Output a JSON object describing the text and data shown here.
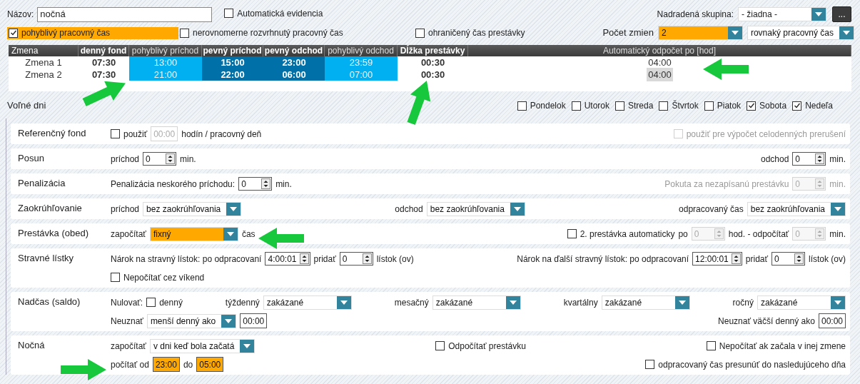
{
  "header": {
    "name_label": "Názov:",
    "name_value": "nočná",
    "auto_evidence": {
      "label": "Automatická evidencia",
      "checked": false
    },
    "parent_group_label": "Nadradená skupina:",
    "parent_group_value": "- žiadna -",
    "more_button": "..."
  },
  "options": [
    {
      "label": "pohyblivý pracovný čas",
      "checked": true
    },
    {
      "label": "nerovnomerne rozvrhnutý pracovný čas",
      "checked": false
    },
    {
      "label": "ohraničený čas prestávky",
      "checked": false
    }
  ],
  "shift_count": {
    "label": "Počet zmien",
    "value": "2",
    "highlighted": true
  },
  "work_time_mode": {
    "value": "rovnaký pracovný čas"
  },
  "shifts_table": {
    "columns": [
      {
        "label": "Zmena",
        "kind": "name"
      },
      {
        "label": "denný fond",
        "kind": "fund"
      },
      {
        "label": "pohyblivý príchod",
        "kind": "flex"
      },
      {
        "label": "pevný príchod",
        "kind": "fixed"
      },
      {
        "label": "pevný odchod",
        "kind": "fixed"
      },
      {
        "label": "pohyblivý odchod",
        "kind": "flex"
      },
      {
        "label": "Dĺžka prestávky",
        "kind": "break"
      },
      {
        "label": "Automatický odpočet po [hod]",
        "kind": "auto"
      }
    ],
    "rows": [
      {
        "cells": [
          "Zmena 1",
          "07:30",
          "13:00",
          "15:00",
          "23:00",
          "23:59",
          "00:30",
          "04:00"
        ],
        "focused": false
      },
      {
        "cells": [
          "Zmena 2",
          "07:30",
          "21:00",
          "22:00",
          "06:00",
          "07:00",
          "00:30",
          "04:00"
        ],
        "focused": true
      }
    ]
  },
  "free_days": {
    "label": "Voľné dni",
    "days": [
      {
        "label": "Pondelok",
        "checked": false
      },
      {
        "label": "Utorok",
        "checked": false
      },
      {
        "label": "Streda",
        "checked": false
      },
      {
        "label": "Štvrtok",
        "checked": false
      },
      {
        "label": "Piatok",
        "checked": false
      },
      {
        "label": "Sobota",
        "checked": true
      },
      {
        "label": "Nedeľa",
        "checked": true
      }
    ]
  },
  "sections": [
    {
      "title": "Referenčný fond",
      "lines": [
        {
          "groups": [
            {
              "items": [
                {
                  "kind": "checkbox",
                  "label": "použiť",
                  "checked": false,
                  "disabled": false
                },
                {
                  "kind": "time",
                  "value": "00:00",
                  "highlighted": false,
                  "disabled": true
                },
                {
                  "kind": "text",
                  "text": "hodín / pracovný deň",
                  "disabled": false
                }
              ]
            },
            {
              "items": [
                {
                  "kind": "checkbox",
                  "label": "použiť pre výpočet celodenných prerušení",
                  "checked": false,
                  "disabled": true
                }
              ]
            }
          ]
        }
      ]
    },
    {
      "title": "Posun",
      "lines": [
        {
          "groups": [
            {
              "items": [
                {
                  "kind": "text",
                  "text": "príchod",
                  "disabled": false
                },
                {
                  "kind": "spinner",
                  "value": "0",
                  "disabled": false
                },
                {
                  "kind": "text",
                  "text": "min.",
                  "disabled": false
                }
              ]
            },
            {
              "items": [
                {
                  "kind": "text",
                  "text": "odchod",
                  "disabled": false
                },
                {
                  "kind": "spinner",
                  "value": "0",
                  "disabled": false
                },
                {
                  "kind": "text",
                  "text": "min.",
                  "disabled": false
                }
              ]
            }
          ]
        }
      ]
    },
    {
      "title": "Penalizácia",
      "lines": [
        {
          "groups": [
            {
              "items": [
                {
                  "kind": "text",
                  "text": "Penalizácia neskorého príchodu:",
                  "disabled": false
                },
                {
                  "kind": "spinner",
                  "value": "0",
                  "disabled": false
                },
                {
                  "kind": "text",
                  "text": "min.",
                  "disabled": false
                }
              ]
            },
            {
              "items": [
                {
                  "kind": "text",
                  "text": "Pokuta za nezapísanú prestávku",
                  "disabled": true
                },
                {
                  "kind": "spinner",
                  "value": "0",
                  "disabled": true
                },
                {
                  "kind": "text",
                  "text": "min.",
                  "disabled": true
                }
              ]
            }
          ]
        }
      ]
    },
    {
      "title": "Zaokrúhľovanie",
      "lines": [
        {
          "groups": [
            {
              "items": [
                {
                  "kind": "text",
                  "text": "príchod",
                  "disabled": false
                },
                {
                  "kind": "select",
                  "value": "bez zaokrúhľovania",
                  "highlighted": false
                }
              ]
            },
            {
              "items": [
                {
                  "kind": "text",
                  "text": "odchod",
                  "disabled": false
                },
                {
                  "kind": "select",
                  "value": "bez zaokrúhľovania",
                  "highlighted": false
                }
              ]
            },
            {
              "items": [
                {
                  "kind": "text",
                  "text": "odpracovaný čas",
                  "disabled": false
                },
                {
                  "kind": "select",
                  "value": "bez zaokrúhľovania",
                  "highlighted": false
                }
              ]
            }
          ]
        }
      ]
    },
    {
      "title": "Prestávka (obed)",
      "lines": [
        {
          "groups": [
            {
              "items": [
                {
                  "kind": "text",
                  "text": "započítať",
                  "disabled": false
                },
                {
                  "kind": "select",
                  "value": "fixný",
                  "highlighted": true
                },
                {
                  "kind": "text",
                  "text": "čas",
                  "disabled": false
                }
              ]
            },
            {
              "items": [
                {
                  "kind": "checkbox",
                  "label": "2. prestávka automaticky",
                  "checked": false,
                  "disabled": false
                },
                {
                  "kind": "text",
                  "text": "po",
                  "disabled": false
                },
                {
                  "kind": "spinner",
                  "value": "0",
                  "disabled": true
                },
                {
                  "kind": "text",
                  "text": "hod. - odpočítať",
                  "disabled": false
                },
                {
                  "kind": "spinner",
                  "value": "0",
                  "disabled": true
                },
                {
                  "kind": "text",
                  "text": "min.",
                  "disabled": false
                }
              ]
            }
          ]
        }
      ]
    },
    {
      "title": "Stravné lístky",
      "lines": [
        {
          "groups": [
            {
              "items": [
                {
                  "kind": "text",
                  "text": "Nárok na stravný lístok: po odpracovaní",
                  "disabled": false
                },
                {
                  "kind": "spinner",
                  "value": "4:00:01",
                  "disabled": false
                },
                {
                  "kind": "text",
                  "text": "pridať",
                  "disabled": false
                },
                {
                  "kind": "spinner",
                  "value": "0",
                  "disabled": false
                },
                {
                  "kind": "text",
                  "text": "lístok (ov)",
                  "disabled": false
                }
              ]
            },
            {
              "items": [
                {
                  "kind": "text",
                  "text": "Nárok na ďalší stravný lístok: po odpracovaní",
                  "disabled": false
                },
                {
                  "kind": "spinner",
                  "value": "12:00:01",
                  "disabled": false
                },
                {
                  "kind": "text",
                  "text": "pridať",
                  "disabled": false
                },
                {
                  "kind": "spinner",
                  "value": "0",
                  "disabled": false
                },
                {
                  "kind": "text",
                  "text": "lístok (ov)",
                  "disabled": false
                }
              ]
            }
          ]
        },
        {
          "groups": [
            {
              "items": [
                {
                  "kind": "checkbox",
                  "label": "Nepočítať cez víkend",
                  "checked": false,
                  "disabled": false
                }
              ]
            }
          ]
        }
      ]
    },
    {
      "title": "Nadčas (saldo)",
      "lines": [
        {
          "groups": [
            {
              "items": [
                {
                  "kind": "text",
                  "text": "Nulovať:",
                  "disabled": false
                },
                {
                  "kind": "checkbox",
                  "label": "denný",
                  "checked": false,
                  "disabled": false
                }
              ]
            },
            {
              "items": [
                {
                  "kind": "text",
                  "text": "týždenný",
                  "disabled": false
                },
                {
                  "kind": "select",
                  "value": "zakázané",
                  "highlighted": false
                }
              ]
            },
            {
              "items": [
                {
                  "kind": "text",
                  "text": "mesačný",
                  "disabled": false
                },
                {
                  "kind": "select",
                  "value": "zakázané",
                  "highlighted": false
                }
              ]
            },
            {
              "items": [
                {
                  "kind": "text",
                  "text": "kvartálny",
                  "disabled": false
                },
                {
                  "kind": "select",
                  "value": "zakázané",
                  "highlighted": false
                }
              ]
            },
            {
              "items": [
                {
                  "kind": "text",
                  "text": "ročný",
                  "disabled": false
                },
                {
                  "kind": "select",
                  "value": "zakázané",
                  "highlighted": false
                }
              ]
            }
          ]
        },
        {
          "groups": [
            {
              "items": [
                {
                  "kind": "text",
                  "text": "Neuznať",
                  "disabled": false
                },
                {
                  "kind": "select",
                  "value": "menší denný ako",
                  "highlighted": false
                },
                {
                  "kind": "time",
                  "value": "00:00",
                  "highlighted": false,
                  "disabled": false
                }
              ]
            },
            {
              "items": [
                {
                  "kind": "text",
                  "text": "Neuznať väčší denný ako",
                  "disabled": false
                },
                {
                  "kind": "time",
                  "value": "00:00",
                  "highlighted": false,
                  "disabled": false
                }
              ]
            }
          ]
        }
      ]
    },
    {
      "title": "Nočná",
      "lines": [
        {
          "groups": [
            {
              "items": [
                {
                  "kind": "text",
                  "text": "započítať",
                  "disabled": false
                },
                {
                  "kind": "select",
                  "value": "v dni keď bola začatá",
                  "highlighted": false
                }
              ]
            },
            {
              "items": [
                {
                  "kind": "checkbox",
                  "label": "Odpočítať prestávku",
                  "checked": false,
                  "disabled": false
                }
              ]
            },
            {
              "items": [
                {
                  "kind": "checkbox",
                  "label": "Nepočítať ak začala v inej zmene",
                  "checked": false,
                  "disabled": false
                }
              ]
            }
          ]
        },
        {
          "groups": [
            {
              "items": [
                {
                  "kind": "text",
                  "text": "počítať od",
                  "disabled": false
                },
                {
                  "kind": "time",
                  "value": "23:00",
                  "highlighted": true,
                  "disabled": false
                },
                {
                  "kind": "text",
                  "text": "do",
                  "disabled": false
                },
                {
                  "kind": "time",
                  "value": "05:00",
                  "highlighted": true,
                  "disabled": false
                }
              ]
            },
            {
              "items": [
                {
                  "kind": "checkbox",
                  "label": "odpracovaný čas presunúť do nasledujúceho dňa",
                  "checked": false,
                  "disabled": false
                }
              ]
            }
          ]
        }
      ]
    }
  ]
}
